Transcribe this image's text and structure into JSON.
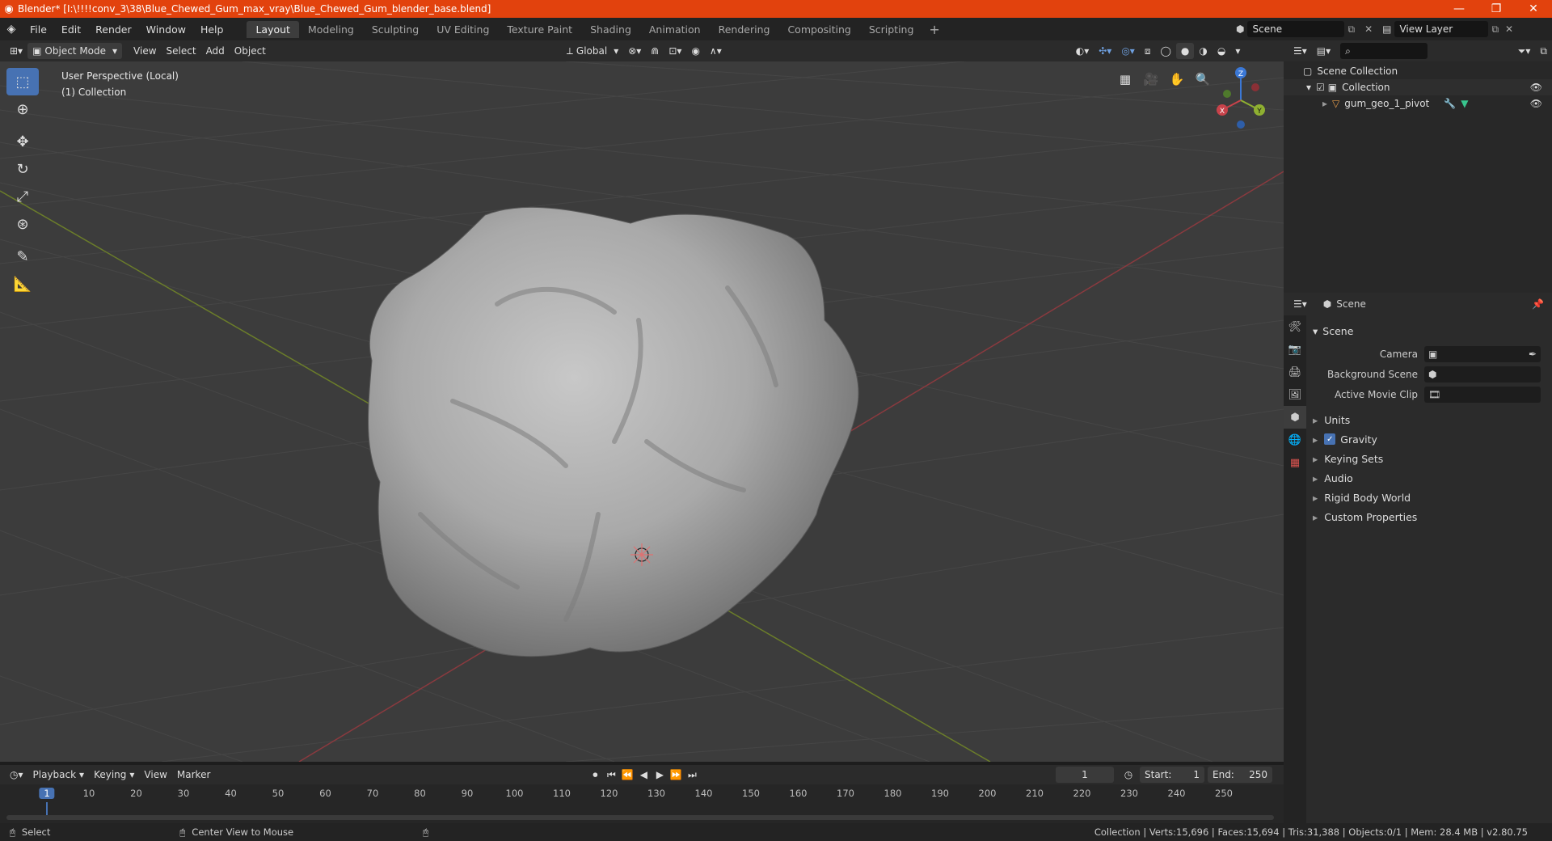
{
  "titlebar": {
    "title": "Blender* [I:\\!!!!conv_3\\38\\Blue_Chewed_Gum_max_vray\\Blue_Chewed_Gum_blender_base.blend]",
    "minimize": "—",
    "restore": "❐",
    "close": "✕"
  },
  "menu": [
    "File",
    "Edit",
    "Render",
    "Window",
    "Help"
  ],
  "workspaces": [
    "Layout",
    "Modeling",
    "Sculpting",
    "UV Editing",
    "Texture Paint",
    "Shading",
    "Animation",
    "Rendering",
    "Compositing",
    "Scripting"
  ],
  "active_workspace": "Layout",
  "scene_selector": {
    "scene": "Scene",
    "view_layer": "View Layer"
  },
  "viewport_header": {
    "mode": "Object Mode",
    "menus": [
      "View",
      "Select",
      "Add",
      "Object"
    ],
    "orientation": "Global"
  },
  "viewport": {
    "perspective_label": "User Perspective (Local)",
    "collection_label": "(1) Collection",
    "gizmo": {
      "x": "X",
      "y": "Y",
      "z": "Z"
    }
  },
  "outliner": {
    "scene_collection": "Scene Collection",
    "collection": "Collection",
    "object": "gum_geo_1_pivot"
  },
  "properties": {
    "context": "Scene",
    "panel_title": "Scene",
    "fields": [
      {
        "label": "Camera",
        "value": ""
      },
      {
        "label": "Background Scene",
        "value": ""
      },
      {
        "label": "Active Movie Clip",
        "value": ""
      }
    ],
    "sections": [
      "Units",
      "Gravity",
      "Keying Sets",
      "Audio",
      "Rigid Body World",
      "Custom Properties"
    ]
  },
  "timeline": {
    "menus": [
      "Playback",
      "Keying",
      "View",
      "Marker"
    ],
    "current_frame": "1",
    "start_label": "Start:",
    "start": "1",
    "end_label": "End:",
    "end": "250",
    "ticks": [
      "1",
      "10",
      "20",
      "30",
      "40",
      "50",
      "60",
      "70",
      "80",
      "90",
      "100",
      "110",
      "120",
      "130",
      "140",
      "150",
      "160",
      "170",
      "180",
      "190",
      "200",
      "210",
      "220",
      "230",
      "240",
      "250"
    ]
  },
  "statusbar": {
    "select": "Select",
    "center_view": "Center View to Mouse",
    "stats": "Collection | Verts:15,696 | Faces:15,694 | Tris:31,388 | Objects:0/1 | Mem: 28.4 MB | v2.80.75"
  },
  "colors": {
    "titlebar": "#e2420d",
    "accent": "#4772b3",
    "x_axis": "#c8424a",
    "y_axis": "#8fb031",
    "z_axis": "#3b78d6"
  }
}
